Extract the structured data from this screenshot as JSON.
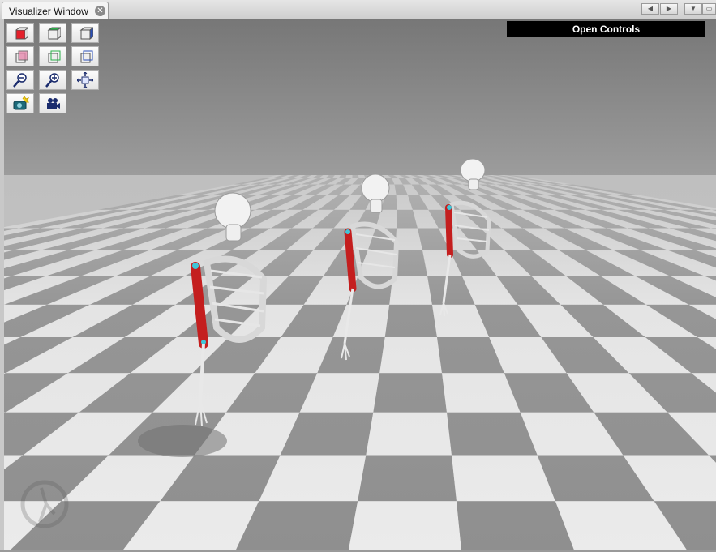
{
  "window": {
    "tab_title": "Visualizer Window",
    "close_glyph": "✕"
  },
  "tab_nav": {
    "prev_glyph": "◀",
    "next_glyph": "▶",
    "menu_glyph": "▼",
    "maximize_glyph": "▭"
  },
  "overlay": {
    "open_controls_label": "Open Controls"
  },
  "toolbar": {
    "buttons": [
      {
        "icon": "view-front-icon"
      },
      {
        "icon": "view-top-icon"
      },
      {
        "icon": "view-right-icon"
      },
      {
        "icon": "view-back-icon"
      },
      {
        "icon": "view-bottom-icon"
      },
      {
        "icon": "view-left-icon"
      },
      {
        "icon": "zoom-out-icon"
      },
      {
        "icon": "zoom-in-icon"
      },
      {
        "icon": "fit-to-view-icon"
      },
      {
        "icon": "snapshot-icon"
      },
      {
        "icon": "record-movie-icon"
      }
    ]
  },
  "colors": {
    "sky_top": "#777777",
    "sky_bottom": "#9c9c9c",
    "floor_dark": "#8f8f8f",
    "floor_light": "#ebebeb",
    "muscle": "#c41e1e",
    "bone": "#f2f2f2",
    "cyan_marker": "#3fc6d8"
  }
}
